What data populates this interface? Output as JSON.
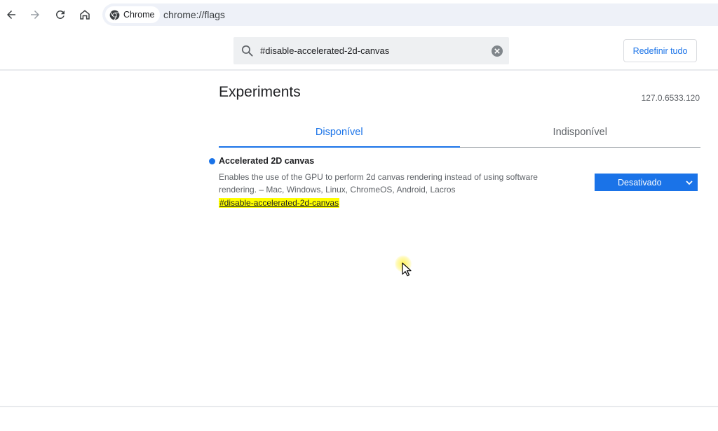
{
  "browser": {
    "site_chip_label": "Chrome",
    "url": "chrome://flags"
  },
  "flags": {
    "search_value": "#disable-accelerated-2d-canvas",
    "reset_label": "Redefinir tudo",
    "title": "Experiments",
    "version": "127.0.6533.120",
    "tabs": [
      {
        "label": "Disponível",
        "active": true
      },
      {
        "label": "Indisponível",
        "active": false
      }
    ],
    "experiments": [
      {
        "title": "Accelerated 2D canvas",
        "description": "Enables the use of the GPU to perform 2d canvas rendering instead of using software rendering. – Mac, Windows, Linux, ChromeOS, Android, Lacros",
        "link": "#disable-accelerated-2d-canvas",
        "selected_option": "Desativado"
      }
    ]
  },
  "colors": {
    "accent": "#1a73e8",
    "highlight": "#ffff00",
    "omnibox_bg": "#eef1f8"
  }
}
